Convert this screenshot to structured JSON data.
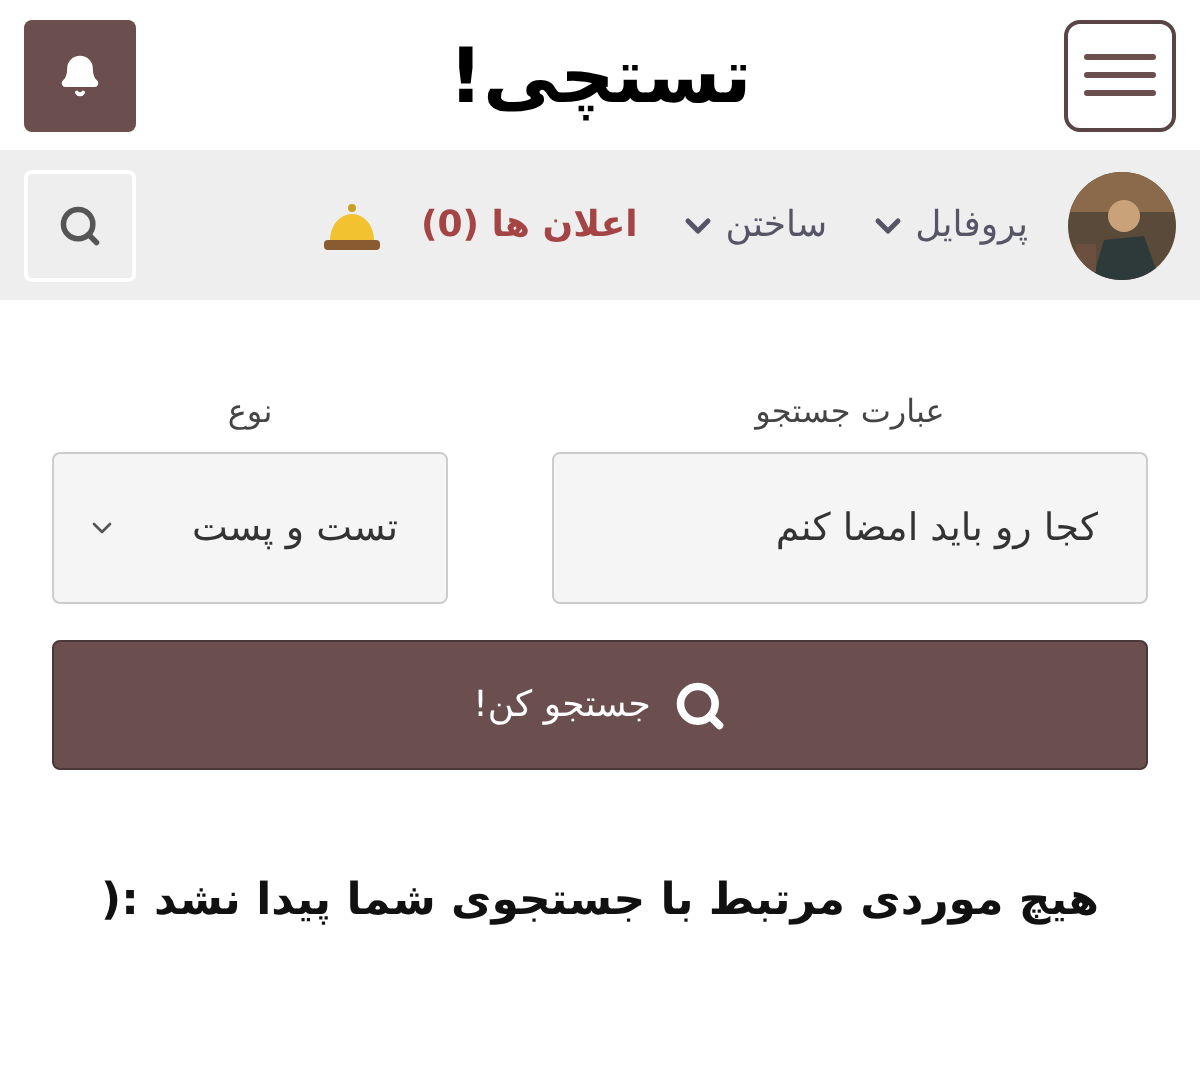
{
  "header": {
    "logo": "تستچی!"
  },
  "nav": {
    "items": [
      {
        "label": "پروفایل"
      },
      {
        "label": "ساختن"
      }
    ],
    "notifications": "اعلان ها (0)"
  },
  "form": {
    "query_label": "عبارت جستجو",
    "query_value": "کجا رو باید امضا کنم",
    "type_label": "نوع",
    "type_value": "تست و پست",
    "submit": "جستجو کن!"
  },
  "result": "هیچ موردی مرتبط با جستجوی شما پیدا نشد :("
}
